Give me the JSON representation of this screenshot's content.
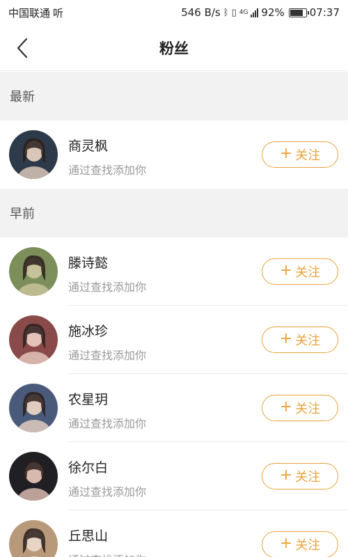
{
  "status_bar": {
    "carrier": "中国联通",
    "carrier_extra": "听",
    "net_speed": "546 B/s",
    "network_type": "4G",
    "battery": "92%",
    "battery_level": 0.92,
    "time": "07:37"
  },
  "nav": {
    "title": "粉丝"
  },
  "sections": [
    {
      "title": "最新"
    },
    {
      "title": "早前"
    }
  ],
  "rows": [
    {
      "name": "商灵枫",
      "subtitle": "通过查找添加你",
      "button": "关注",
      "avatar_colors": [
        "#2c3a4a",
        "#d9c6b8"
      ]
    },
    {
      "name": "滕诗懿",
      "subtitle": "通过查找添加你",
      "button": "关注",
      "avatar_colors": [
        "#7c8f5a",
        "#c8c29a"
      ]
    },
    {
      "name": "施冰珍",
      "subtitle": "通过查找添加你",
      "button": "关注",
      "avatar_colors": [
        "#8a4a4a",
        "#e4c4b8"
      ]
    },
    {
      "name": "农星玥",
      "subtitle": "通过查找添加你",
      "button": "关注",
      "avatar_colors": [
        "#4a5a7a",
        "#e2ccc0"
      ]
    },
    {
      "name": "徐尔白",
      "subtitle": "通过查找添加你",
      "button": "关注",
      "avatar_colors": [
        "#1f1f24",
        "#d8b9ae"
      ]
    },
    {
      "name": "丘思山",
      "subtitle": "通过查找添加你",
      "button": "关注",
      "avatar_colors": [
        "#b89a7a",
        "#e8d4c4"
      ]
    }
  ],
  "colors": {
    "accent": "#e8a33d",
    "section_bg": "#f2f2f2",
    "subtitle": "#999999"
  }
}
